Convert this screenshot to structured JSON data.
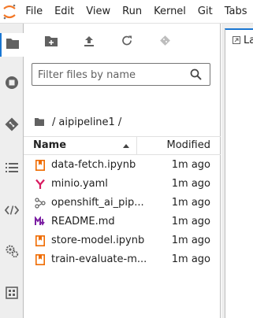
{
  "menubar": {
    "items": [
      "File",
      "Edit",
      "View",
      "Run",
      "Kernel",
      "Git",
      "Tabs"
    ]
  },
  "activity": {
    "icons": [
      "folder-icon",
      "stop-circle-icon",
      "git-icon",
      "list-icon",
      "code-icon",
      "settings-gears-icon",
      "extension-icon"
    ]
  },
  "filebrowser": {
    "filter_placeholder": "Filter files by name",
    "breadcrumb": {
      "sep1": "/",
      "folder": "aipipeline1",
      "sep2": "/"
    },
    "columns": {
      "name": "Name",
      "modified": "Modified"
    },
    "files": [
      {
        "name": "data-fetch.ipynb",
        "modified": "1m ago",
        "icon": "notebook-icon"
      },
      {
        "name": "minio.yaml",
        "modified": "1m ago",
        "icon": "yaml-icon"
      },
      {
        "name": "openshift_ai_pip...",
        "modified": "1m ago",
        "icon": "pipeline-icon"
      },
      {
        "name": "README.md",
        "modified": "1m ago",
        "icon": "markdown-icon"
      },
      {
        "name": "store-model.ipynb",
        "modified": "1m ago",
        "icon": "notebook-icon"
      },
      {
        "name": "train-evaluate-m...",
        "modified": "1m ago",
        "icon": "notebook-icon"
      }
    ]
  },
  "main": {
    "tab_label": "La"
  },
  "colors": {
    "accent": "#1976d2",
    "notebook": "#ef6c00",
    "yaml": "#d81b60",
    "markdown": "#7b1fa2"
  }
}
